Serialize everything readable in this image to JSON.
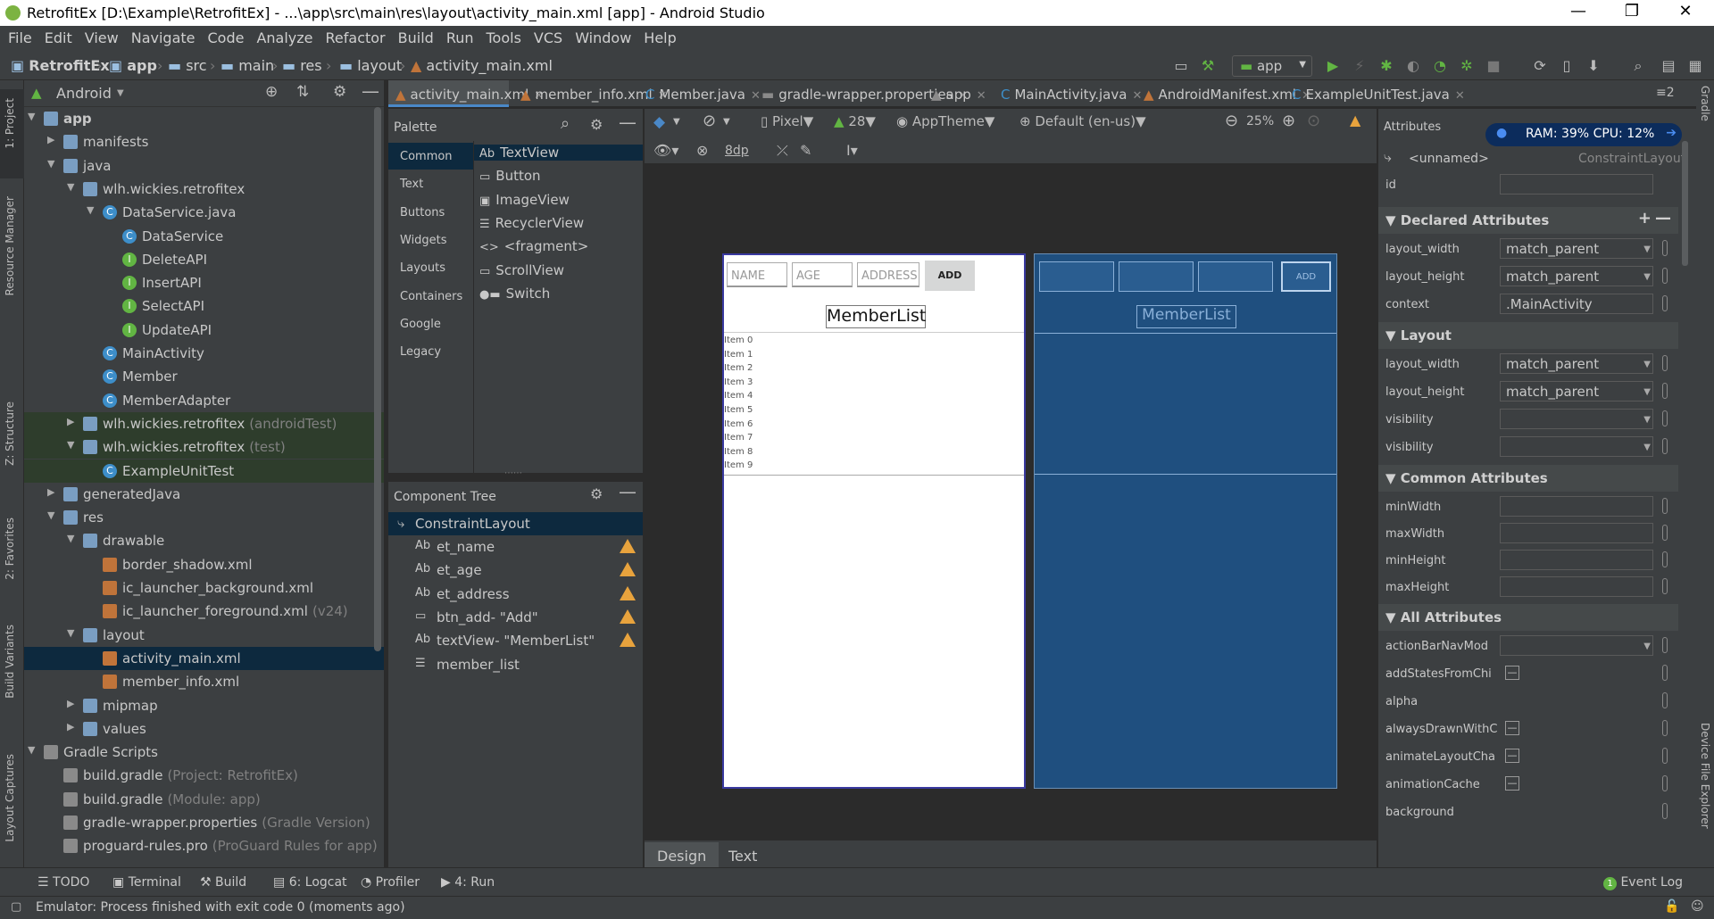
{
  "window": {
    "title": "RetrofitEx [D:\\Example\\RetrofitEx] - ...\\app\\src\\main\\res\\layout\\activity_main.xml [app] - Android Studio",
    "minimize": "—",
    "maximize": "❐",
    "close": "✕"
  },
  "menu": [
    "File",
    "Edit",
    "View",
    "Navigate",
    "Code",
    "Analyze",
    "Refactor",
    "Build",
    "Run",
    "Tools",
    "VCS",
    "Window",
    "Help"
  ],
  "breadcrumb": [
    "RetrofitEx",
    "app",
    "src",
    "main",
    "res",
    "layout",
    "activity_main.xml"
  ],
  "run_config": "app",
  "left_tabs": [
    "1: Project",
    "Resource Manager",
    "Z: Structure",
    "2: Favorites",
    "Build Variants",
    "Layout Captures"
  ],
  "right_tabs": [
    "Gradle",
    "Device File Explorer"
  ],
  "project": {
    "view": "Android",
    "tree": [
      {
        "label": "app",
        "indent": 0,
        "arrow": "▼",
        "icon": "folder",
        "bold": true
      },
      {
        "label": "manifests",
        "indent": 1,
        "arrow": "▶",
        "icon": "folder"
      },
      {
        "label": "java",
        "indent": 1,
        "arrow": "▼",
        "icon": "folder"
      },
      {
        "label": "wlh.wickies.retrofitex",
        "indent": 2,
        "arrow": "▼",
        "icon": "folder"
      },
      {
        "label": "DataService.java",
        "indent": 3,
        "arrow": "▼",
        "icon": "class"
      },
      {
        "label": "DataService",
        "indent": 4,
        "arrow": "",
        "icon": "class"
      },
      {
        "label": "DeleteAPI",
        "indent": 4,
        "arrow": "",
        "icon": "iface"
      },
      {
        "label": "InsertAPI",
        "indent": 4,
        "arrow": "",
        "icon": "iface"
      },
      {
        "label": "SelectAPI",
        "indent": 4,
        "arrow": "",
        "icon": "iface"
      },
      {
        "label": "UpdateAPI",
        "indent": 4,
        "arrow": "",
        "icon": "iface"
      },
      {
        "label": "MainActivity",
        "indent": 3,
        "arrow": "",
        "icon": "class"
      },
      {
        "label": "Member",
        "indent": 3,
        "arrow": "",
        "icon": "class"
      },
      {
        "label": "MemberAdapter",
        "indent": 3,
        "arrow": "",
        "icon": "class"
      },
      {
        "label": "wlh.wickies.retrofitex",
        "suffix": "(androidTest)",
        "indent": 2,
        "arrow": "▶",
        "icon": "folder",
        "green": true
      },
      {
        "label": "wlh.wickies.retrofitex",
        "suffix": "(test)",
        "indent": 2,
        "arrow": "▼",
        "icon": "folder",
        "green": true
      },
      {
        "label": "ExampleUnitTest",
        "indent": 3,
        "arrow": "",
        "icon": "class",
        "green": true
      },
      {
        "label": "generatedJava",
        "indent": 1,
        "arrow": "▶",
        "icon": "folder"
      },
      {
        "label": "res",
        "indent": 1,
        "arrow": "▼",
        "icon": "folder"
      },
      {
        "label": "drawable",
        "indent": 2,
        "arrow": "▼",
        "icon": "folder"
      },
      {
        "label": "border_shadow.xml",
        "indent": 3,
        "arrow": "",
        "icon": "xml"
      },
      {
        "label": "ic_launcher_background.xml",
        "indent": 3,
        "arrow": "",
        "icon": "xml"
      },
      {
        "label": "ic_launcher_foreground.xml",
        "suffix": "(v24)",
        "indent": 3,
        "arrow": "",
        "icon": "xml"
      },
      {
        "label": "layout",
        "indent": 2,
        "arrow": "▼",
        "icon": "folder"
      },
      {
        "label": "activity_main.xml",
        "indent": 3,
        "arrow": "",
        "icon": "xml",
        "selected": true
      },
      {
        "label": "member_info.xml",
        "indent": 3,
        "arrow": "",
        "icon": "xml"
      },
      {
        "label": "mipmap",
        "indent": 2,
        "arrow": "▶",
        "icon": "folder"
      },
      {
        "label": "values",
        "indent": 2,
        "arrow": "▶",
        "icon": "folder"
      },
      {
        "label": "Gradle Scripts",
        "indent": 0,
        "arrow": "▼",
        "icon": "grad"
      },
      {
        "label": "build.gradle",
        "suffix": "(Project: RetrofitEx)",
        "indent": 1,
        "arrow": "",
        "icon": "grad"
      },
      {
        "label": "build.gradle",
        "suffix": "(Module: app)",
        "indent": 1,
        "arrow": "",
        "icon": "grad"
      },
      {
        "label": "gradle-wrapper.properties",
        "suffix": "(Gradle Version)",
        "indent": 1,
        "arrow": "",
        "icon": "grad"
      },
      {
        "label": "proguard-rules.pro",
        "suffix": "(ProGuard Rules for app)",
        "indent": 1,
        "arrow": "",
        "icon": "grad"
      }
    ]
  },
  "tabs": [
    {
      "label": "activity_main.xml",
      "active": true
    },
    {
      "label": "member_info.xml"
    },
    {
      "label": "Member.java"
    },
    {
      "label": "gradle-wrapper.properties"
    },
    {
      "label": "app"
    },
    {
      "label": "MainActivity.java"
    },
    {
      "label": "AndroidManifest.xml"
    },
    {
      "label": "ExampleUnitTest.java"
    }
  ],
  "tab_overflow": "≡2",
  "palette": {
    "title": "Palette",
    "categories": [
      "Common",
      "Text",
      "Buttons",
      "Widgets",
      "Layouts",
      "Containers",
      "Google",
      "Legacy"
    ],
    "items": [
      {
        "icon": "Ab",
        "label": "TextView"
      },
      {
        "icon": "▭",
        "label": "Button"
      },
      {
        "icon": "▣",
        "label": "ImageView"
      },
      {
        "icon": "☰",
        "label": "RecyclerView"
      },
      {
        "icon": "<>",
        "label": "<fragment>"
      },
      {
        "icon": "▭",
        "label": "ScrollView"
      },
      {
        "icon": "●▬",
        "label": "Switch"
      }
    ]
  },
  "component_tree": {
    "title": "Component Tree",
    "root": "ConstraintLayout",
    "items": [
      {
        "icon": "Ab",
        "label": "et_name",
        "warn": true
      },
      {
        "icon": "Ab",
        "label": "et_age",
        "warn": true
      },
      {
        "icon": "Ab",
        "label": "et_address",
        "warn": true
      },
      {
        "icon": "▭",
        "label": "btn_add- \"Add\"",
        "warn": true
      },
      {
        "icon": "Ab",
        "label": "textView- \"MemberList\"",
        "warn": true
      },
      {
        "icon": "☰",
        "label": "member_list",
        "warn": false
      }
    ]
  },
  "design_toolbar": {
    "device": "Pixel",
    "api": "28",
    "theme": "AppTheme",
    "locale": "Default (en-us)",
    "zoom": "25%",
    "margin": "8dp"
  },
  "preview": {
    "name_hint": "NAME",
    "age_hint": "AGE",
    "address_hint": "ADDRESS",
    "add_button": "ADD",
    "title": "MemberList",
    "items": [
      "Item 0",
      "Item 1",
      "Item 2",
      "Item 3",
      "Item 4",
      "Item 5",
      "Item 6",
      "Item 7",
      "Item 8",
      "Item 9"
    ],
    "blueprint_title": "MemberList",
    "blueprint_add": "ADD"
  },
  "design_tabs": [
    "Design",
    "Text"
  ],
  "attributes": {
    "title": "Attributes",
    "component": "<unnamed>",
    "component_type": "ConstraintLayout",
    "ram": "RAM: 39%",
    "cpu": "CPU: 12%",
    "id_label": "id",
    "declared": {
      "title": "Declared Attributes",
      "rows": [
        {
          "name": "layout_width",
          "value": "match_parent"
        },
        {
          "name": "layout_height",
          "value": "match_parent"
        },
        {
          "name": "context",
          "value": ".MainActivity"
        }
      ]
    },
    "layout": {
      "title": "Layout",
      "rows": [
        {
          "name": "layout_width",
          "value": "match_parent"
        },
        {
          "name": "layout_height",
          "value": "match_parent"
        },
        {
          "name": "visibility",
          "value": ""
        },
        {
          "name": "visibility",
          "value": ""
        }
      ]
    },
    "common": {
      "title": "Common Attributes",
      "rows": [
        "minWidth",
        "maxWidth",
        "minHeight",
        "maxHeight"
      ]
    },
    "all": {
      "title": "All Attributes",
      "rows": [
        "actionBarNavMod",
        "addStatesFromChi",
        "alpha",
        "alwaysDrawnWithC",
        "animateLayoutCha",
        "animationCache",
        "background"
      ]
    }
  },
  "bottom_tools": [
    "TODO",
    "Terminal",
    "Build",
    "6: Logcat",
    "Profiler",
    "4: Run"
  ],
  "event_log": "Event Log",
  "event_count": "1",
  "status": "Emulator: Process finished with exit code 0 (moments ago)"
}
